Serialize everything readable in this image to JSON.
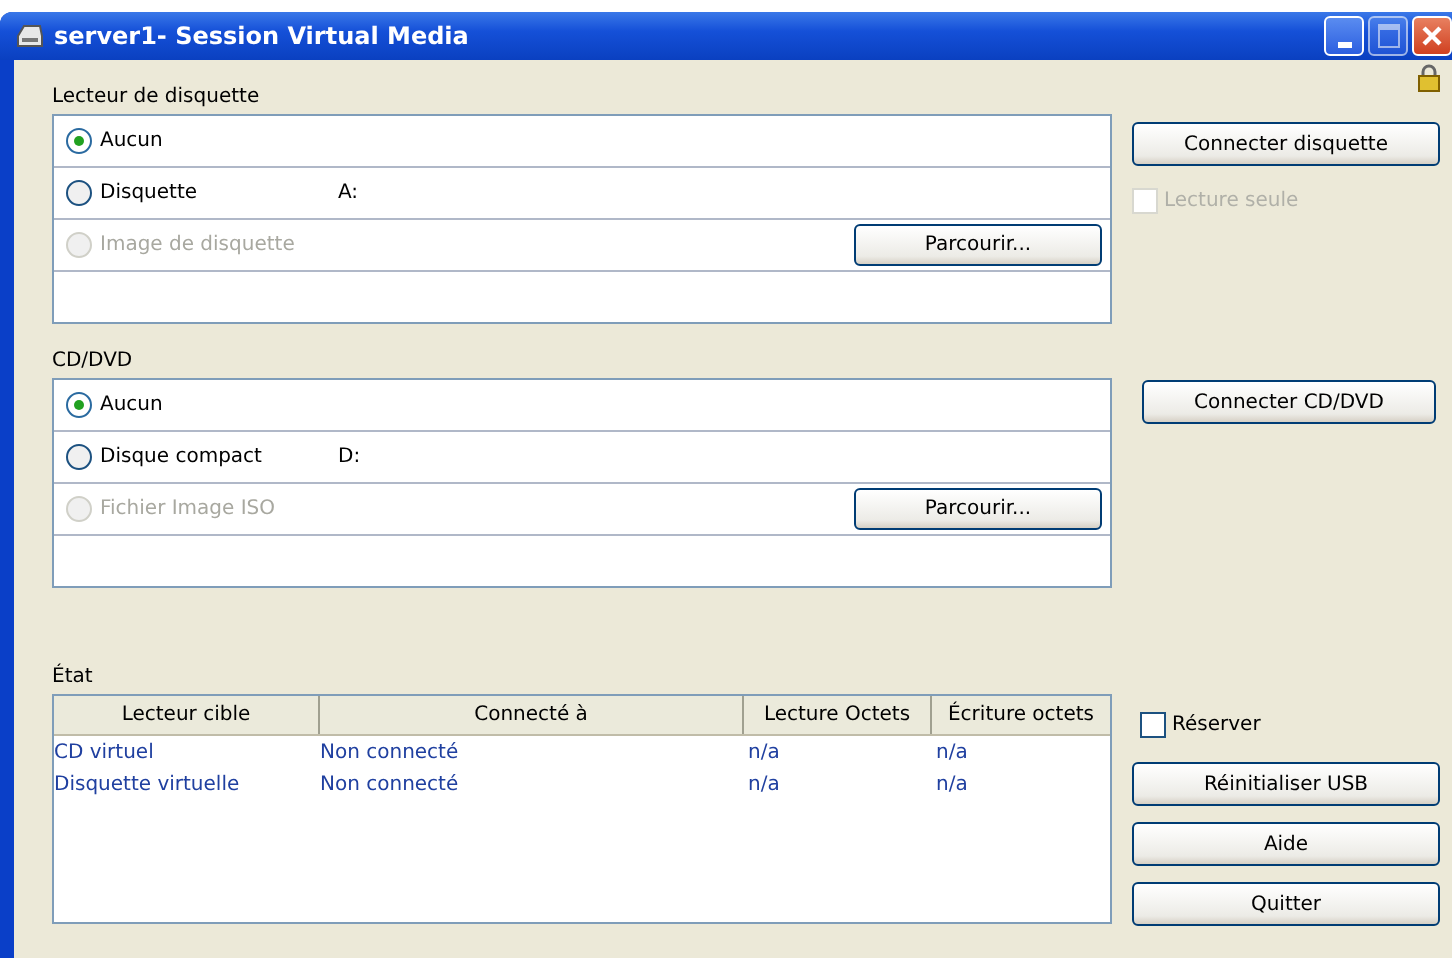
{
  "window": {
    "title": "server1- Session Virtual Media"
  },
  "sections": [
    {
      "title": "Lecteur de disquette",
      "options": [
        {
          "label": "Aucun",
          "selected": true,
          "disabled": false
        },
        {
          "label": "Disquette",
          "drive": "A:",
          "selected": false,
          "disabled": false
        },
        {
          "label": "Image de disquette",
          "selected": false,
          "disabled": true
        }
      ],
      "browse_button": "Parcourir...",
      "connect_button": "Connecter disquette",
      "read_only": {
        "label": "Lecture seule",
        "checked": false,
        "disabled": true
      }
    },
    {
      "title": "CD/DVD",
      "options": [
        {
          "label": "Aucun",
          "selected": true,
          "disabled": false
        },
        {
          "label": "Disque compact",
          "drive": "D:",
          "selected": false,
          "disabled": false
        },
        {
          "label": "Fichier Image ISO",
          "selected": false,
          "disabled": true
        }
      ],
      "browse_button": "Parcourir...",
      "connect_button": "Connecter CD/DVD"
    }
  ],
  "status": {
    "title": "État",
    "columns": [
      "Lecteur cible",
      "Connecté à",
      "Lecture Octets",
      "Écriture octets"
    ],
    "rows": [
      [
        "CD virtuel",
        "Non connecté",
        "n/a",
        "n/a"
      ],
      [
        "Disquette virtuelle",
        "Non connecté",
        "n/a",
        "n/a"
      ]
    ]
  },
  "reserve": {
    "label": "Réserver",
    "checked": false
  },
  "buttons": [
    "Réinitialiser USB",
    "Aide",
    "Quitter"
  ]
}
